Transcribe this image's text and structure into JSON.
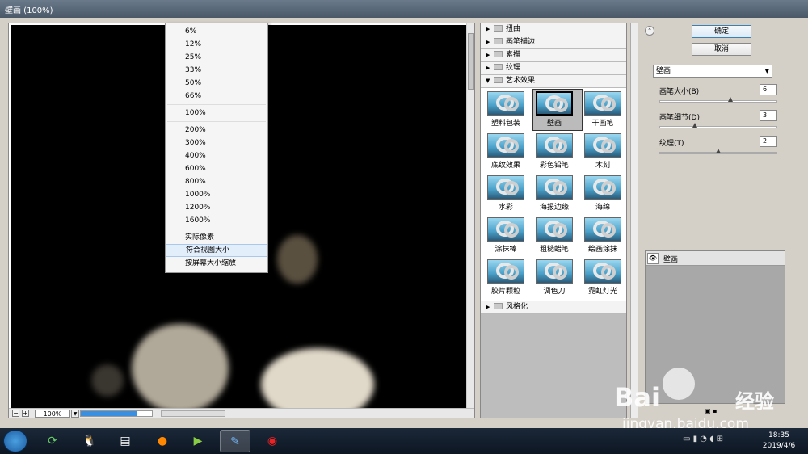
{
  "window": {
    "title": "壁画 (100%)"
  },
  "zoom_menu": {
    "group1": [
      "6%",
      "12%",
      "25%",
      "33%",
      "50%",
      "66%"
    ],
    "group2": [
      "100%"
    ],
    "group3": [
      "200%",
      "300%",
      "400%",
      "600%",
      "800%",
      "1000%",
      "1200%",
      "1600%"
    ],
    "group4": [
      "实际像素",
      "符合视图大小",
      "按屏幕大小缩放"
    ],
    "highlighted": "符合视图大小"
  },
  "preview": {
    "zoom_value": "100%",
    "progress": 0.8
  },
  "filter_categories": {
    "top": [
      "扭曲",
      "画笔描边",
      "素描",
      "纹理"
    ],
    "expanded": "艺术效果",
    "bottom": "风格化"
  },
  "artistic_filters": [
    [
      "塑料包装",
      "壁画",
      "干画笔"
    ],
    [
      "底纹效果",
      "彩色铅笔",
      "木刻"
    ],
    [
      "水彩",
      "海报边缘",
      "海绵"
    ],
    [
      "涂抹棒",
      "粗糙蜡笔",
      "绘画涂抹"
    ],
    [
      "胶片颗粒",
      "调色刀",
      "霓虹灯光"
    ]
  ],
  "selected_filter": "壁画",
  "buttons": {
    "ok": "确定",
    "cancel": "取消"
  },
  "settings": {
    "filter_select": "壁画",
    "params": [
      {
        "label": "画笔大小(B)",
        "value": "6",
        "position": 0.6
      },
      {
        "label": "画笔细节(D)",
        "value": "3",
        "position": 0.3
      },
      {
        "label": "纹理(T)",
        "value": "2",
        "position": 0.5
      }
    ]
  },
  "layers": {
    "name": "壁画"
  },
  "watermark": {
    "brand": "Bai",
    "brand_cn": "经验",
    "url": "jingyan.baidu.com"
  },
  "taskbar": {
    "time": "18:35",
    "date": "2019/4/6"
  },
  "icons": {
    "eye": "eye-icon",
    "collapse": "chevron-up-icon",
    "start": "windows-start-icon"
  }
}
